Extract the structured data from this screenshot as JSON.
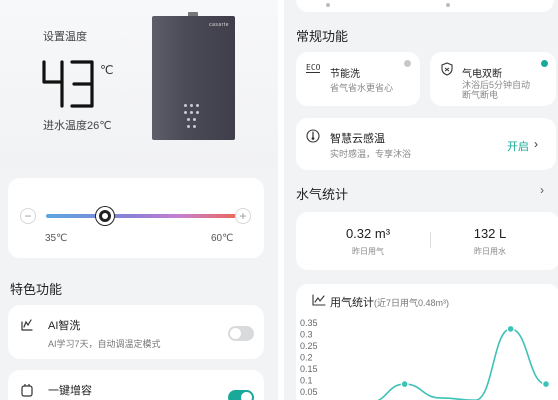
{
  "left": {
    "hero": {
      "label": "设置温度",
      "temperature": "43",
      "unit": "℃",
      "inlet_text": "进水温度26℃",
      "heater_brand": "casarte"
    },
    "slider": {
      "minus": "−",
      "plus": "+",
      "min_label": "35℃",
      "max_label": "60℃"
    },
    "features": {
      "title": "特色功能",
      "ai_wash": {
        "name": "AI智洗",
        "sub": "AI学习7天，自动调温定模式",
        "enabled": false
      },
      "boost": {
        "name": "一键增容",
        "enabled": true
      }
    }
  },
  "right": {
    "regular_title": "常规功能",
    "eco": {
      "badge": "ECO",
      "name": "节能洗",
      "sub": "省气省水更省心"
    },
    "cutoff": {
      "name": "气电双断",
      "sub_line1": "沐浴后5分钟自动",
      "sub_line2": "断气断电"
    },
    "cloud": {
      "name": "智慧云感温",
      "sub": "实时感温，专享沐浴",
      "action": "开启"
    },
    "stats": {
      "title": "水气统计",
      "gas_value": "0.32 m³",
      "gas_label": "昨日用气",
      "water_value": "132 L",
      "water_label": "昨日用水"
    },
    "chart_title": "用气统计",
    "chart_subtitle": "(近7日用气0.48m³)"
  },
  "colors": {
    "accent": "#1aa89a",
    "toggle_off": "#d9dadc",
    "toggle_on": "#1aa89a",
    "knob": "#222222",
    "line": "#3ec1b7"
  },
  "chart_data": {
    "type": "line",
    "title": "用气统计",
    "subtitle": "(近7日用气0.48m³)",
    "yticks": [
      "0.35",
      "0.3",
      "0.25",
      "0.2",
      "0.15",
      "0.1",
      "0.05"
    ],
    "ylim": [
      0,
      0.35
    ],
    "grid": false,
    "series": [
      {
        "values": [
          0.0,
          0.0,
          0.08,
          0.02,
          0.01,
          0.32,
          0.08
        ]
      }
    ],
    "marker_points": [
      2,
      5,
      6
    ]
  }
}
